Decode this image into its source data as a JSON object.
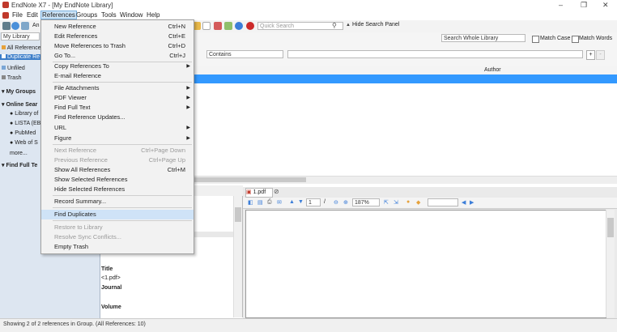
{
  "window": {
    "title": "EndNote X7 - [My EndNote Library]",
    "controls": [
      "–",
      "❐",
      "✕"
    ]
  },
  "menubar": [
    "File",
    "Edit",
    "References",
    "Groups",
    "Tools",
    "Window",
    "Help"
  ],
  "toolbar": {
    "style_partial": "An",
    "quick_search_placeholder": "Quick Search",
    "hide_search_label": "Hide Search Panel"
  },
  "search": {
    "library_select": "My Library",
    "scope": "Search Whole Library",
    "match_case": "Match Case",
    "match_words": "Match Words",
    "condition": "Contains"
  },
  "sidebar": {
    "all_references": "All References",
    "duplicate": "Duplicate Re",
    "unfiled": "Unfiled",
    "trash": "Trash",
    "my_groups": "My Groups",
    "online_search": "Online Sear",
    "online_items": [
      "Library of",
      "LISTA (EB",
      "PubMed",
      "Web of S"
    ],
    "more": "more...",
    "find_full_text": "Find Full Te"
  },
  "references_menu": [
    {
      "label": "New Reference",
      "shortcut": "Ctrl+N"
    },
    {
      "label": "Edit References",
      "shortcut": "Ctrl+E"
    },
    {
      "label": "Move References to Trash",
      "shortcut": "Ctrl+D"
    },
    {
      "label": "Go To...",
      "shortcut": "Ctrl+J"
    },
    {
      "label": "Copy References To",
      "shortcut": ""
    },
    {
      "label": "E-mail Reference",
      "shortcut": ""
    },
    {
      "label": "File Attachments",
      "shortcut": ""
    },
    {
      "label": "PDF Viewer",
      "shortcut": ""
    },
    {
      "label": "Find Full Text",
      "shortcut": ""
    },
    {
      "label": "Find Reference Updates...",
      "shortcut": ""
    },
    {
      "label": "URL",
      "shortcut": ""
    },
    {
      "label": "Figure",
      "shortcut": ""
    },
    {
      "label": "Next Reference",
      "shortcut": "Ctrl+Page Down"
    },
    {
      "label": "Previous Reference",
      "shortcut": "Ctrl+Page Up"
    },
    {
      "label": "Show All References",
      "shortcut": "Ctrl+M"
    },
    {
      "label": "Show Selected References",
      "shortcut": ""
    },
    {
      "label": "Hide Selected References",
      "shortcut": ""
    },
    {
      "label": "Record Summary...",
      "shortcut": ""
    },
    {
      "label": "Find Duplicates",
      "shortcut": ""
    },
    {
      "label": "Restore to Library",
      "shortcut": ""
    },
    {
      "label": "Resolve Sync Conflicts...",
      "shortcut": ""
    },
    {
      "label": "Empty Trash",
      "shortcut": ""
    }
  ],
  "reference_list": {
    "author_header": "Author"
  },
  "detail": {
    "title_label": "Title",
    "title_value": "<1.pdf>",
    "journal_label": "Journal",
    "volume_label": "Volume"
  },
  "pdf_viewer": {
    "tab": "1.pdf",
    "page": "1",
    "zoom": "187%"
  },
  "status": {
    "text": "Showing 2 of 2 references in Group. (All References: 10)"
  }
}
